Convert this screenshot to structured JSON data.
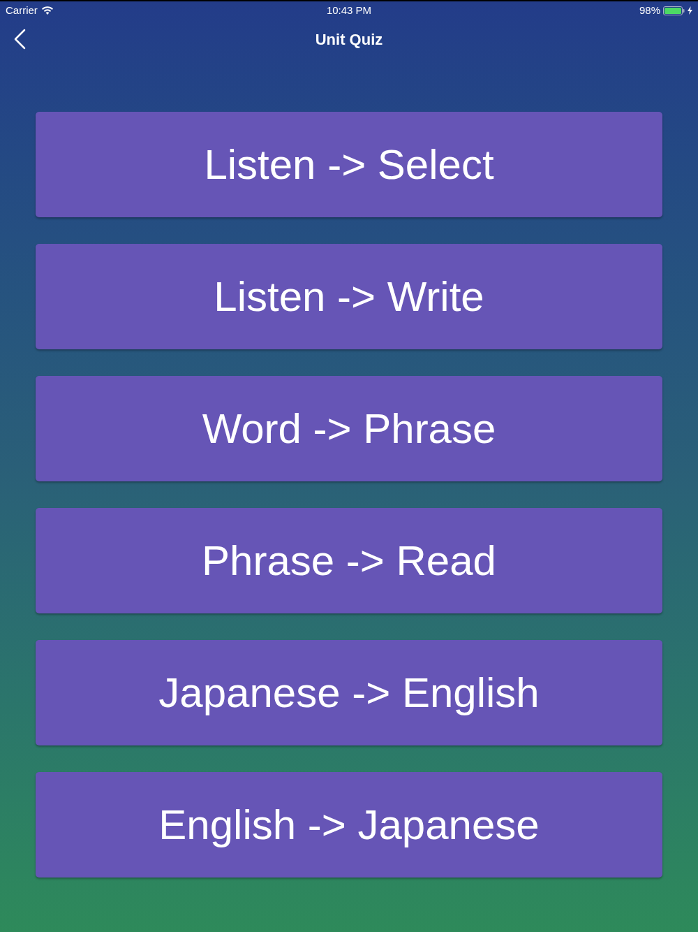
{
  "status_bar": {
    "carrier": "Carrier",
    "time": "10:43 PM",
    "battery": "98%"
  },
  "nav_bar": {
    "title": "Unit Quiz"
  },
  "quiz_options": [
    "Listen -> Select",
    "Listen -> Write",
    "Word -> Phrase",
    "Phrase -> Read",
    "Japanese -> English",
    "English -> Japanese"
  ]
}
